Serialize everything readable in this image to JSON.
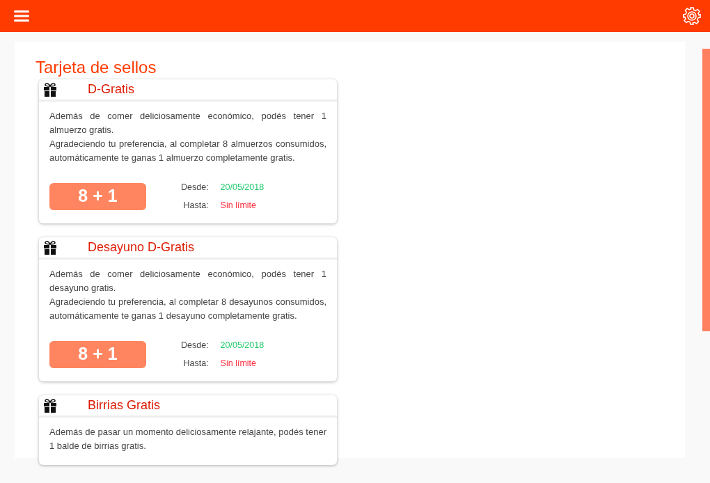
{
  "page_title": "Tarjeta de sellos",
  "cards": [
    {
      "title": "D-Gratis",
      "paragraphs": [
        "Además de comer deliciosamente económico, podés tener 1 almuerzo gratis.",
        "Agradeciendo tu preferencia, al completar 8 almuerzos consumidos, automáticamente te ganas 1 almuerzo completamente gratis."
      ],
      "badge": "8 + 1",
      "from_label": "Desde:",
      "from": "20/05/2018",
      "until_label": "Hasta:",
      "until": "Sin límite"
    },
    {
      "title": "Desayuno D-Gratis",
      "paragraphs": [
        "Además de comer deliciosamente económico, podés tener 1 desayuno gratis.",
        "Agradeciendo tu preferencia, al completar 8 desayunos consumidos, automáticamente te ganas 1 desayuno completamente gratis."
      ],
      "badge": "8 + 1",
      "from_label": "Desde:",
      "from": "20/05/2018",
      "until_label": "Hasta:",
      "until": "Sin límite"
    },
    {
      "title": "Birrias Gratis",
      "paragraphs": [
        "Además de pasar un momento deliciosamente relajante, podés tener 1 balde de birrias gratis."
      ]
    }
  ]
}
